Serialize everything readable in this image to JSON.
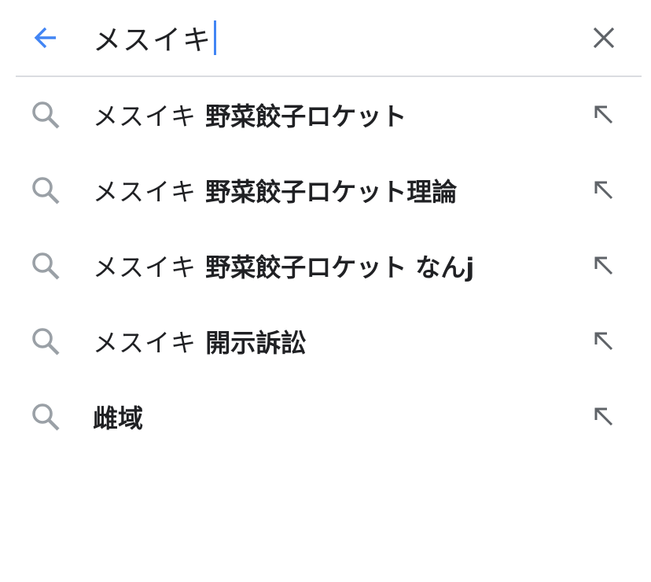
{
  "search": {
    "query": "メスイキ",
    "back_icon": "arrow-left-icon",
    "clear_icon": "close-icon",
    "accent_color": "#4285f4"
  },
  "suggestions": [
    {
      "prefix": "メスイキ ",
      "completion": "野菜餃子ロケット",
      "icon": "search-icon",
      "action_icon": "arrow-up-left-icon"
    },
    {
      "prefix": "メスイキ ",
      "completion": "野菜餃子ロケット理論",
      "icon": "search-icon",
      "action_icon": "arrow-up-left-icon"
    },
    {
      "prefix": "メスイキ ",
      "completion": "野菜餃子ロケット なんj",
      "icon": "search-icon",
      "action_icon": "arrow-up-left-icon"
    },
    {
      "prefix": "メスイキ ",
      "completion": "開示訴訟",
      "icon": "search-icon",
      "action_icon": "arrow-up-left-icon"
    },
    {
      "prefix": "",
      "completion": "雌域",
      "icon": "search-icon",
      "action_icon": "arrow-up-left-icon"
    }
  ]
}
